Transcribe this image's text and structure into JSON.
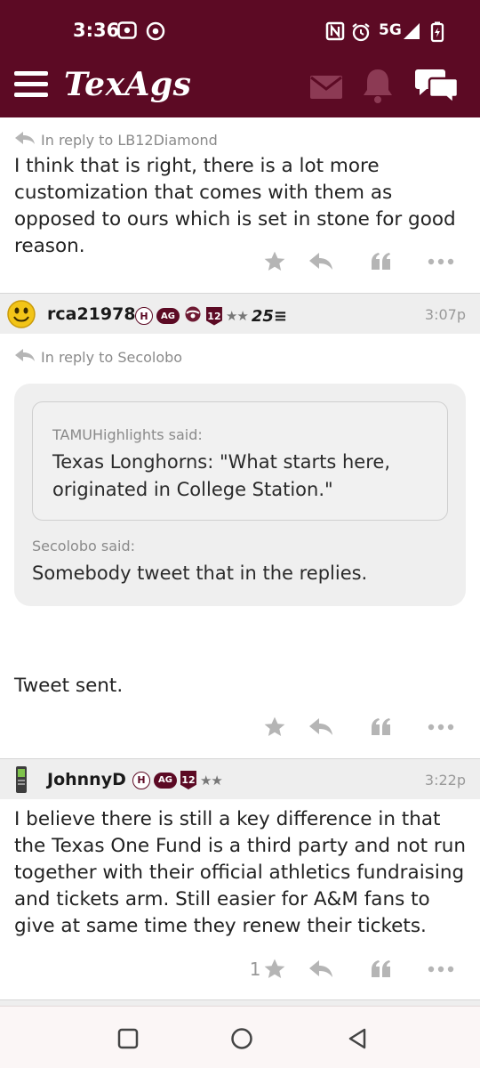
{
  "status_bar": {
    "time": "3:36",
    "network": "5G"
  },
  "header": {
    "logo": "TexAgs",
    "icons": [
      "menu-icon",
      "mail-icon",
      "bell-icon",
      "chat-icon"
    ],
    "brand_color": "#5c0a24"
  },
  "posts": [
    {
      "reply_to": "In reply to LB12Diamond",
      "body": "I think that is right, there is a lot more customization that comes with them as opposed to ours which is set in stone for good reason.",
      "like_count": ""
    },
    {
      "username": "rca21978",
      "badges": [
        "H",
        "AG",
        "12",
        "★★",
        "25"
      ],
      "time": "3:07p",
      "reply_to": "In reply to Secolobo",
      "quote_inner": {
        "author": "TAMUHighlights said:",
        "text": "Texas Longhorns: \"What starts here, originated in College Station.\""
      },
      "quote_outer": {
        "author": "Secolobo said:",
        "text": "Somebody tweet that in the replies."
      },
      "body": "Tweet sent.",
      "like_count": ""
    },
    {
      "username": "JohnnyD",
      "badges": [
        "H",
        "AG",
        "12",
        "★★"
      ],
      "time": "3:22p",
      "body": "I believe there is still a key difference in that the Texas One Fund is a third party and not run together with their official athletics fundraising and tickets arm. Still easier for A&M fans to give at same time they renew their tickets.",
      "like_count": "1"
    }
  ],
  "action_icons": [
    "star-icon",
    "reply-icon",
    "quote-icon",
    "more-icon"
  ],
  "nav_bar": [
    "square-icon",
    "circle-icon",
    "triangle-back-icon"
  ]
}
